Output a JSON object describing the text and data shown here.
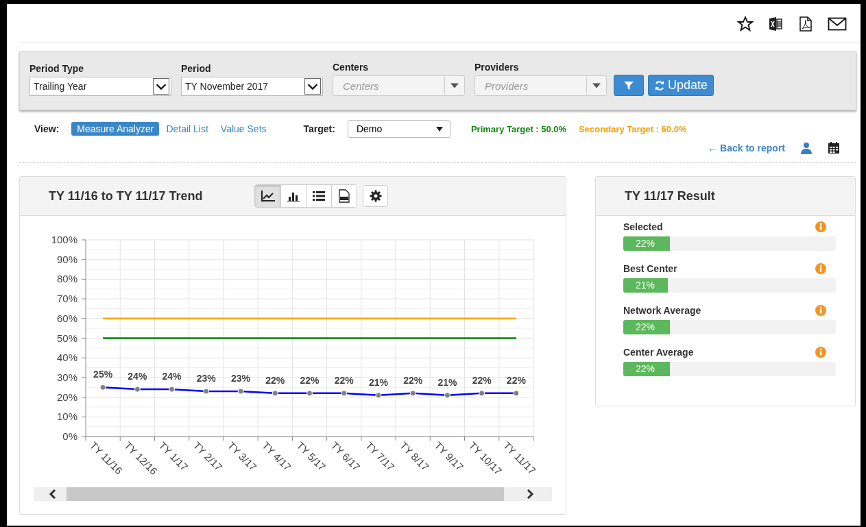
{
  "filters": [
    {
      "label": "Period Type",
      "kind": "select",
      "value": "Trailing Year"
    },
    {
      "label": "Period",
      "kind": "select",
      "value": "TY November 2017"
    },
    {
      "label": "Centers",
      "kind": "combo",
      "placeholder": "Centers"
    },
    {
      "label": "Providers",
      "kind": "combo",
      "placeholder": "Providers"
    }
  ],
  "update_button": "Update",
  "view": {
    "label": "View:",
    "options": [
      {
        "label": "Measure Analyzer",
        "selected": true
      },
      {
        "label": "Detail List",
        "selected": false
      },
      {
        "label": "Value Sets",
        "selected": false
      }
    ]
  },
  "target": {
    "label": "Target:",
    "value": "Demo"
  },
  "primary_target": "Primary Target : 50.0%",
  "secondary_target": "Secondary Target : 60.0%",
  "back_link": "← Back to report",
  "trend": {
    "title": "TY 11/16 to TY 11/17 Trend",
    "chart_types": [
      {
        "kind": "line",
        "selected": true
      },
      {
        "kind": "bar",
        "selected": false
      },
      {
        "kind": "list",
        "selected": false
      },
      {
        "kind": "xls",
        "selected": false
      }
    ],
    "chart_data": {
      "type": "line",
      "grid": true,
      "categories": [
        "TY 11/16",
        "TY 12/16",
        "TY 1/17",
        "TY 2/17",
        "TY 3/17",
        "TY 4/17",
        "TY 5/17",
        "TY 6/17",
        "TY 7/17",
        "TY 8/17",
        "TY 9/17",
        "TY 10/17",
        "TY 11/17"
      ],
      "ylim": [
        0,
        100
      ],
      "yticks": [
        {
          "value": 0,
          "label": "0%"
        },
        {
          "value": 10,
          "label": "10%"
        },
        {
          "value": 20,
          "label": "20%"
        },
        {
          "value": 30,
          "label": "30%"
        },
        {
          "value": 40,
          "label": "40%"
        },
        {
          "value": 50,
          "label": "50%"
        },
        {
          "value": 60,
          "label": "60%"
        },
        {
          "value": 70,
          "label": "70%"
        },
        {
          "value": 80,
          "label": "80%"
        },
        {
          "value": 90,
          "label": "90%"
        },
        {
          "value": 100,
          "label": "100%"
        }
      ],
      "series": [
        {
          "color": "#0000ff",
          "marker": true,
          "values": [
            25,
            24,
            24,
            23,
            23,
            22,
            22,
            22,
            21,
            22,
            21,
            22,
            22
          ],
          "value_labels": [
            "25%",
            "24%",
            "24%",
            "23%",
            "23%",
            "22%",
            "22%",
            "22%",
            "21%",
            "22%",
            "21%",
            "22%",
            "22%"
          ]
        },
        {
          "color": "#008000",
          "values": [
            50,
            50,
            50,
            50,
            50,
            50,
            50,
            50,
            50,
            50,
            50,
            50,
            50
          ]
        },
        {
          "color": "#ffa500",
          "values": [
            60,
            60,
            60,
            60,
            60,
            60,
            60,
            60,
            60,
            60,
            60,
            60,
            60
          ]
        }
      ]
    }
  },
  "result": {
    "title": "TY 11/17 Result",
    "items": [
      {
        "label": "Selected",
        "level": 0.22,
        "reading": "22%"
      },
      {
        "label": "Best Center",
        "level": 0.21,
        "reading": "21%"
      },
      {
        "label": "Network Average",
        "level": 0.22,
        "reading": "22%"
      },
      {
        "label": "Center Average",
        "level": 0.22,
        "reading": "22%"
      }
    ]
  }
}
